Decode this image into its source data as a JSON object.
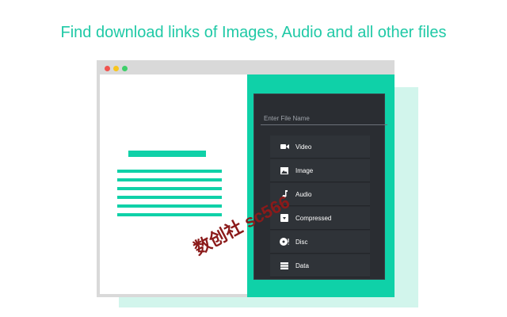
{
  "headline": "Find download links of Images, Audio and all other files",
  "colors": {
    "accent": "#0fd1a8",
    "headline": "#1fc9a6",
    "popup_bg": "#2a2d32",
    "dot_red": "#f0544f",
    "dot_yellow": "#f8c51c",
    "dot_green": "#3ecf6a"
  },
  "window": {
    "dots": [
      "red-dot",
      "yellow-dot",
      "green-dot"
    ]
  },
  "popup": {
    "search_placeholder": "Enter File Name",
    "categories": [
      {
        "label": "Video",
        "icon": "video-camera-icon"
      },
      {
        "label": "Image",
        "icon": "image-icon"
      },
      {
        "label": "Audio",
        "icon": "music-note-icon"
      },
      {
        "label": "Compressed",
        "icon": "archive-icon"
      },
      {
        "label": "Disc",
        "icon": "disc-icon"
      },
      {
        "label": "Data",
        "icon": "database-icon"
      }
    ]
  },
  "watermark": "数创社 sc566"
}
